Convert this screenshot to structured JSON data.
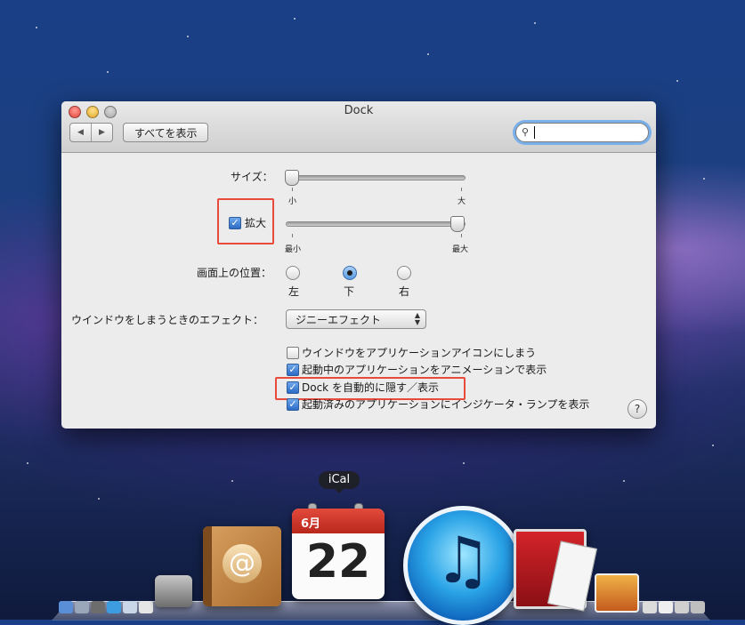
{
  "window": {
    "title": "Dock",
    "nav_back_glyph": "◀",
    "nav_forward_glyph": "▶",
    "show_all_label": "すべてを表示",
    "search_value": ""
  },
  "settings": {
    "size_label": "サイズ：",
    "size_min_label": "小",
    "size_max_label": "大",
    "size_value": 0.0,
    "magnify_label": "拡大",
    "magnify_checked": true,
    "magnify_min_label": "最小",
    "magnify_max_label": "最大",
    "magnify_value": 1.0,
    "position_label": "画面上の位置：",
    "position_options": [
      "左",
      "下",
      "右"
    ],
    "position_selected": "下",
    "minimize_label": "ウインドウをしまうときのエフェクト：",
    "minimize_value": "ジニーエフェクト",
    "checkboxes": [
      {
        "label": "ウインドウをアプリケーションアイコンにしまう",
        "checked": false
      },
      {
        "label": "起動中のアプリケーションをアニメーションで表示",
        "checked": true
      },
      {
        "label": "Dock を自動的に隠す／表示",
        "checked": true
      },
      {
        "label": "起動済みのアプリケーションにインジケータ・ランプを表示",
        "checked": true
      }
    ],
    "help_label": "?"
  },
  "dock": {
    "tooltip": "iCal",
    "ical_month": "6月",
    "ical_day": "22",
    "address_book_glyph": "@",
    "itunes_glyph": "♫",
    "icon_names": [
      "finder-icon",
      "facetime-icon",
      "address-book-icon",
      "ical-icon",
      "itunes-icon",
      "photo-booth-icon",
      "iphoto-icon"
    ]
  },
  "colors": {
    "highlight": "#e84a3b",
    "accent": "#2c6bc7"
  }
}
